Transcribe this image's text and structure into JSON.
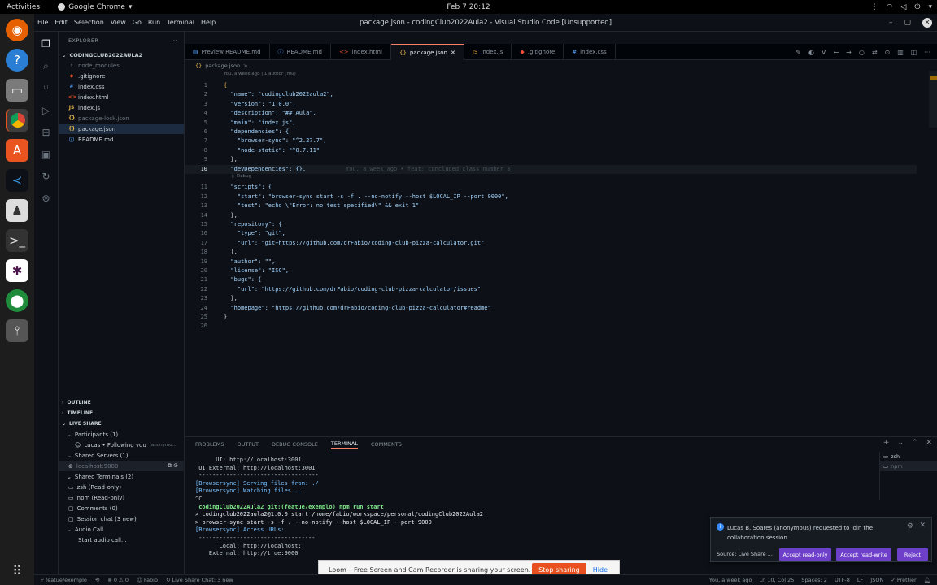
{
  "gnome": {
    "activities": "Activities",
    "app_name": "Google Chrome",
    "clock": "Feb 7  20:12"
  },
  "window": {
    "title": "package.json - codingClub2022Aula2 - Visual Studio Code [Unsupported]",
    "menu": [
      "File",
      "Edit",
      "Selection",
      "View",
      "Go",
      "Run",
      "Terminal",
      "Help"
    ]
  },
  "sidebar": {
    "explorer_label": "EXPLORER",
    "project": "CODINGCLUB2022AULA2",
    "files": [
      {
        "name": "node_modules",
        "icon": "›",
        "dim": true
      },
      {
        "name": ".gitignore",
        "icon": "◆"
      },
      {
        "name": "index.css",
        "icon": "#"
      },
      {
        "name": "index.html",
        "icon": "<>"
      },
      {
        "name": "index.js",
        "icon": "JS"
      },
      {
        "name": "package-lock.json",
        "icon": "{}",
        "dim": true
      },
      {
        "name": "package.json",
        "icon": "{}",
        "selected": true
      },
      {
        "name": "README.md",
        "icon": "ⓘ"
      }
    ],
    "outline": "OUTLINE",
    "timeline": "TIMELINE",
    "live_share": "LIVE SHARE",
    "participants": "Participants (1)",
    "participant_name": "Lucas • Following you",
    "participant_note": "(anonymo...",
    "shared_servers": "Shared Servers (1)",
    "server": "localhost:9000",
    "shared_terminals": "Shared Terminals (2)",
    "terminals": [
      "zsh (Read-only)",
      "npm (Read-only)"
    ],
    "comments": "Comments (0)",
    "session_chat": "Session chat (3 new)",
    "audio_call": "Audio Call",
    "start_audio": "Start audio call..."
  },
  "tabs": [
    {
      "label": "Preview README.md",
      "icon": "▤"
    },
    {
      "label": "README.md",
      "icon": "ⓘ"
    },
    {
      "label": "index.html",
      "icon": "<>"
    },
    {
      "label": "package.json",
      "icon": "{}",
      "active": true
    },
    {
      "label": "index.js",
      "icon": "JS"
    },
    {
      "label": ".gitignore",
      "icon": "◆"
    },
    {
      "label": "index.css",
      "icon": "#"
    }
  ],
  "breadcrumb": {
    "file": "package.json",
    "rest": "> ..."
  },
  "editor": {
    "lens_top": "You, a week ago | 1 author (You)",
    "lens_debug": "▷ Debug",
    "blame": "You, a week ago • feat: concluded class number 3",
    "lines": [
      {
        "n": "1",
        "code": "{"
      },
      {
        "n": "2",
        "code": "  \"name\": \"codingclub2022aula2\","
      },
      {
        "n": "3",
        "code": "  \"version\": \"1.0.0\","
      },
      {
        "n": "4",
        "code": "  \"description\": \"## Aula\","
      },
      {
        "n": "5",
        "code": "  \"main\": \"index.js\","
      },
      {
        "n": "6",
        "code": "  \"dependencies\": {"
      },
      {
        "n": "7",
        "code": "    \"browser-sync\": \"^2.27.7\","
      },
      {
        "n": "8",
        "code": "    \"node-static\": \"^0.7.11\""
      },
      {
        "n": "9",
        "code": "  },"
      },
      {
        "n": "10",
        "code": "  \"devDependencies\": {},"
      },
      {
        "n": "11",
        "code": "  \"scripts\": {"
      },
      {
        "n": "12",
        "code": "    \"start\": \"browser-sync start -s -f . --no-notify --host $LOCAL_IP --port 9000\","
      },
      {
        "n": "13",
        "code": "    \"test\": \"echo \\\"Error: no test specified\\\" && exit 1\""
      },
      {
        "n": "14",
        "code": "  },"
      },
      {
        "n": "15",
        "code": "  \"repository\": {"
      },
      {
        "n": "16",
        "code": "    \"type\": \"git\","
      },
      {
        "n": "17",
        "code": "    \"url\": \"git+https://github.com/drFabio/coding-club-pizza-calculator.git\""
      },
      {
        "n": "18",
        "code": "  },"
      },
      {
        "n": "19",
        "code": "  \"author\": \"\","
      },
      {
        "n": "20",
        "code": "  \"license\": \"ISC\","
      },
      {
        "n": "21",
        "code": "  \"bugs\": {"
      },
      {
        "n": "22",
        "code": "    \"url\": \"https://github.com/drFabio/coding-club-pizza-calculator/issues\""
      },
      {
        "n": "23",
        "code": "  },"
      },
      {
        "n": "24",
        "code": "  \"homepage\": \"https://github.com/drFabio/coding-club-pizza-calculator#readme\""
      },
      {
        "n": "25",
        "code": "}"
      },
      {
        "n": "26",
        "code": ""
      }
    ]
  },
  "panel": {
    "tabs": [
      "PROBLEMS",
      "OUTPUT",
      "DEBUG CONSOLE",
      "TERMINAL",
      "COMMENTS"
    ],
    "active_tab": "TERMINAL",
    "terminal_lines": [
      "      UI: http://localhost:3001",
      " UI External: http://localhost:3001",
      " -----------------------------------",
      "[Browsersync] Serving files from: ./",
      "[Browsersync] Watching files...",
      "^C",
      " codingClub2022Aula2 git:(featue/exemplo) npm run start",
      "",
      "> codingclub2022aula2@1.0.0 start /home/fabio/workspace/personal/codingClub2022Aula2",
      "> browser-sync start -s -f . --no-notify --host $LOCAL_IP --port 9000",
      "",
      "[Browsersync] Access URLs:",
      " ----------------------------------",
      "       Local: http://localhost:",
      "    External: http://true:9000"
    ],
    "term_list": [
      "zsh",
      "npm"
    ]
  },
  "notification": {
    "message": "Lucas B. Soares (anonymous) requested to join the collaboration session.",
    "source": "Source: Live Share ...",
    "accept_ro": "Accept read-only",
    "accept_rw": "Accept read-write",
    "reject": "Reject"
  },
  "sharebar": {
    "text": "Loom – Free Screen and Cam Recorder is sharing your screen.",
    "stop": "Stop sharing",
    "hide": "Hide"
  },
  "status": {
    "branch": "featue/exemplo",
    "sync": "⟲",
    "problems": "⊗ 0 ⚠ 0",
    "user": "Fabio",
    "liveshare": "Live Share Chat: 3 new",
    "blame": "You, a week ago",
    "position": "Ln 10, Col 25",
    "spaces": "Spaces: 2",
    "encoding": "UTF-8",
    "eol": "LF",
    "lang": "JSON",
    "prettier": "✓ Prettier"
  },
  "colors": {
    "accent": "#f78166",
    "button": "#6e40c9",
    "stop": "#e8501f"
  }
}
